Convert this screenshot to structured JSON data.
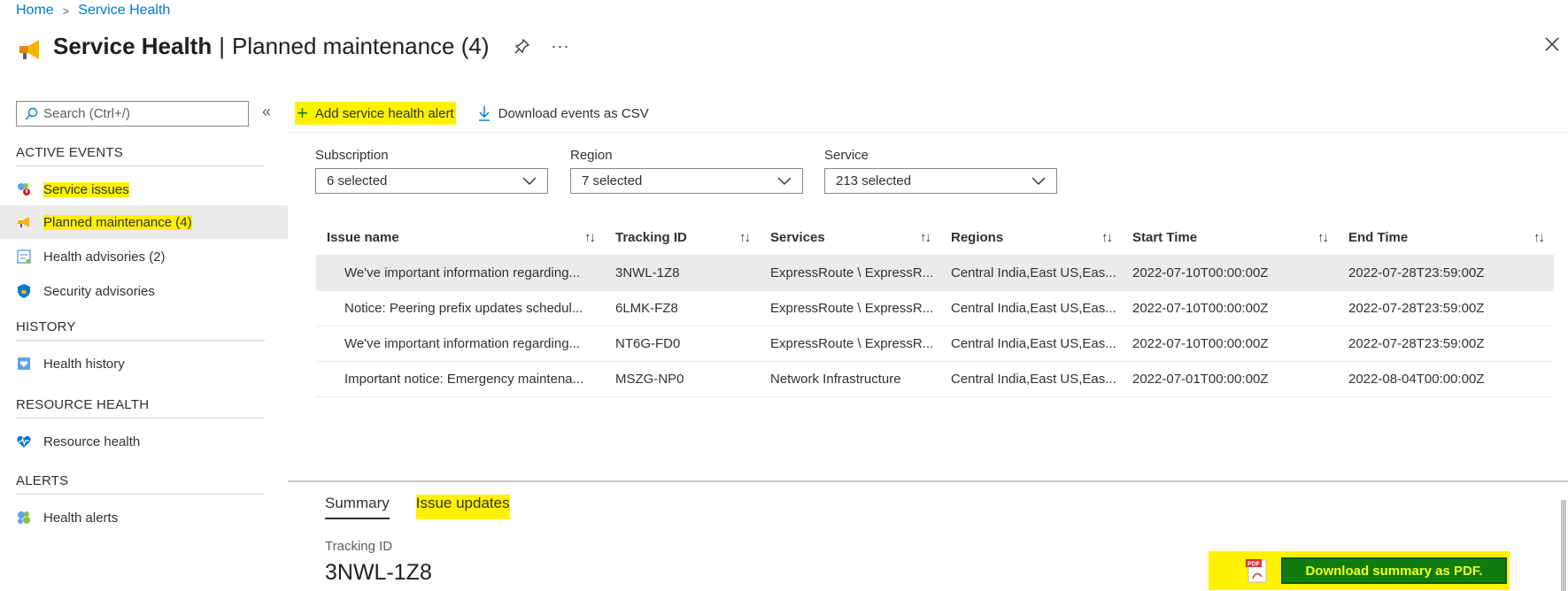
{
  "breadcrumb": {
    "home": "Home",
    "sep": ">",
    "current": "Service Health"
  },
  "header": {
    "title": "Service Health",
    "sep": "|",
    "subtitle": "Planned maintenance (4)",
    "more": "···"
  },
  "search": {
    "placeholder": "Search (Ctrl+/)"
  },
  "collapse_glyph": "«",
  "sidebar": {
    "active_events": "ACTIVE EVENTS",
    "items_active": [
      {
        "label": "Service issues"
      },
      {
        "label": "Planned maintenance (4)"
      },
      {
        "label": "Health advisories (2)"
      },
      {
        "label": "Security advisories"
      }
    ],
    "history": "HISTORY",
    "history_items": [
      {
        "label": "Health history"
      }
    ],
    "resource_health": "RESOURCE HEALTH",
    "resource_items": [
      {
        "label": "Resource health"
      }
    ],
    "alerts": "ALERTS",
    "alerts_items": [
      {
        "label": "Health alerts"
      }
    ]
  },
  "toolbar": {
    "add_alert": "Add service health alert",
    "download_csv": "Download events as CSV"
  },
  "filters": [
    {
      "label": "Subscription",
      "value": "6 selected"
    },
    {
      "label": "Region",
      "value": "7 selected"
    },
    {
      "label": "Service",
      "value": "213 selected"
    }
  ],
  "table": {
    "sort_glyph": "↑↓",
    "columns": [
      "Issue name",
      "Tracking ID",
      "Services",
      "Regions",
      "Start Time",
      "End Time"
    ],
    "rows": [
      [
        "We've important information regarding...",
        "3NWL-1Z8",
        "ExpressRoute \\ ExpressR...",
        "Central India,East US,Eas...",
        "2022-07-10T00:00:00Z",
        "2022-07-28T23:59:00Z"
      ],
      [
        "Notice: Peering prefix updates schedul...",
        "6LMK-FZ8",
        "ExpressRoute \\ ExpressR...",
        "Central India,East US,Eas...",
        "2022-07-10T00:00:00Z",
        "2022-07-28T23:59:00Z"
      ],
      [
        "We've important information regarding...",
        "NT6G-FD0",
        "ExpressRoute \\ ExpressR...",
        "Central India,East US,Eas...",
        "2022-07-10T00:00:00Z",
        "2022-07-28T23:59:00Z"
      ],
      [
        "Important notice: Emergency maintena...",
        "MSZG-NP0",
        "Network Infrastructure",
        "Central India,East US,Eas...",
        "2022-07-01T00:00:00Z",
        "2022-08-04T00:00:00Z"
      ]
    ]
  },
  "detail": {
    "tabs": [
      "Summary",
      "Issue updates"
    ],
    "tracking_label": "Tracking ID",
    "tracking_value": "3NWL-1Z8",
    "pdf_icon_text": "PDF",
    "download_pdf": "Download summary as PDF."
  },
  "colors": {
    "accent": "#0078d4",
    "highlight": "#fff200",
    "pdf_button": "#107c10",
    "selected_row": "#edebe9"
  }
}
